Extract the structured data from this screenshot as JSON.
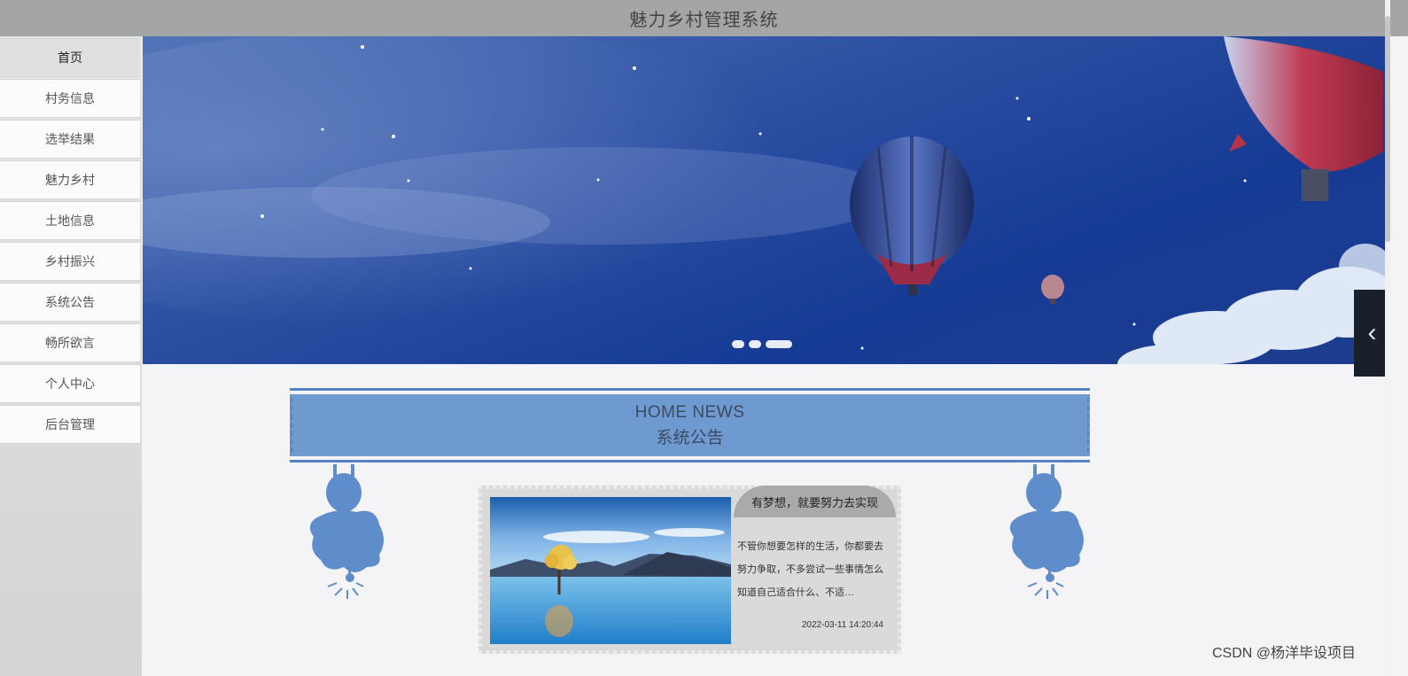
{
  "app": {
    "title": "魅力乡村管理系统"
  },
  "nav": {
    "items": [
      {
        "label": "首页",
        "active": true
      },
      {
        "label": "村务信息"
      },
      {
        "label": "选举结果"
      },
      {
        "label": "魅力乡村"
      },
      {
        "label": "土地信息"
      },
      {
        "label": "乡村振兴"
      },
      {
        "label": "系统公告"
      },
      {
        "label": "畅所欲言"
      },
      {
        "label": "个人中心"
      },
      {
        "label": "后台管理"
      }
    ]
  },
  "carousel": {
    "slide_count": 3,
    "active_index": 2
  },
  "section": {
    "title_en": "HOME NEWS",
    "title_cn": "系统公告"
  },
  "news": [
    {
      "title": "有梦想，就要努力去实现",
      "summary": "不管你想要怎样的生活，你都要去努力争取，不多尝试一些事情怎么知道自己适合什么、不适…",
      "date": "2022-03-11 14:20:44"
    }
  ],
  "watermark": "CSDN @杨洋毕设项目",
  "colors": {
    "topbar": "#a3a5a6",
    "accent": "#6f9ad0",
    "banner": "#1d3d8f"
  }
}
